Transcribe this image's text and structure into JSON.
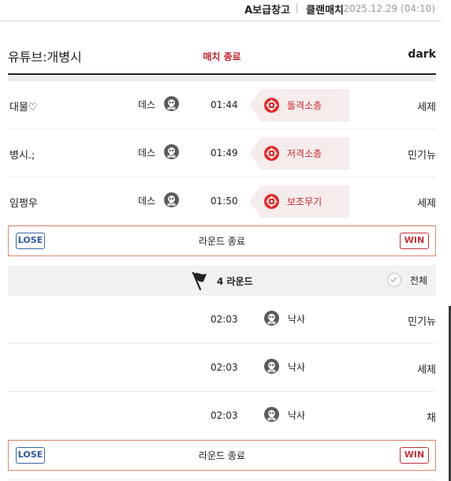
{
  "topbar": {
    "link1": "A보급창고",
    "link2": "클랜매치",
    "datetime": "2025.12.29 (04:10)"
  },
  "match": {
    "left_team": "유튜브:개병시",
    "status": "매치 종료",
    "right_team": "dark"
  },
  "kills_round3": [
    {
      "player": "대물♡",
      "kind": "데스",
      "time": "01:44",
      "weapon": "돌격소총",
      "opponent": "세제"
    },
    {
      "player": "병시.;",
      "kind": "데스",
      "time": "01:49",
      "weapon": "저격소총",
      "opponent": "민기뉴"
    },
    {
      "player": "임쩡우",
      "kind": "데스",
      "time": "01:50",
      "weapon": "보조무기",
      "opponent": "세제"
    }
  ],
  "round_end_1": {
    "lose": "LOSE",
    "label": "라운드 종료",
    "win": "WIN"
  },
  "round4": {
    "label": "4 라운드",
    "filter": "전체"
  },
  "kills_round4": [
    {
      "time": "02:03",
      "action": "낙사",
      "player": "민기뉴"
    },
    {
      "time": "02:03",
      "action": "낙사",
      "player": "세제"
    },
    {
      "time": "02:03",
      "action": "낙사",
      "player": "채"
    }
  ],
  "round_end_2": {
    "lose": "LOSE",
    "label": "라운드 종료",
    "win": "WIN"
  },
  "icons": {
    "skull": "skull-icon",
    "target": "crosshair-icon",
    "flag": "flag-icon",
    "check": "check-icon"
  },
  "colors": {
    "accent_red": "#c0242e",
    "lose_blue": "#2f5aa2",
    "win_red": "#c2323a",
    "border_orange": "#de8a6c"
  }
}
